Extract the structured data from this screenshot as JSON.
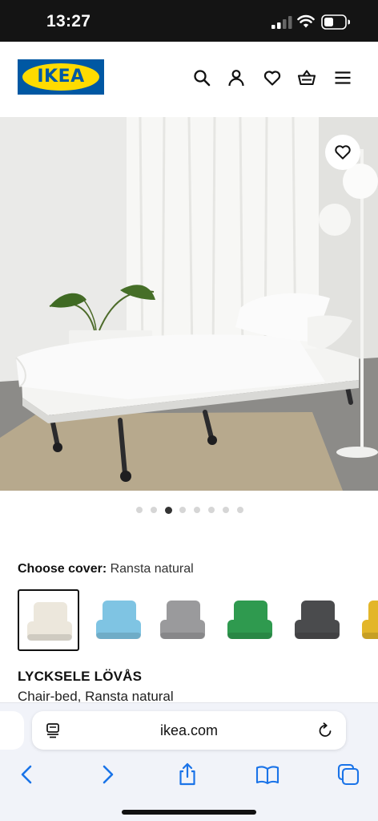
{
  "status_bar": {
    "time": "13:27"
  },
  "header": {
    "logo_text": "IKEA",
    "icons": [
      "search-icon",
      "user-icon",
      "heart-icon",
      "basket-icon",
      "menu-icon"
    ]
  },
  "hero": {
    "favourite_icon": "heart-icon",
    "carousel": {
      "count": 8,
      "active_index": 2
    }
  },
  "cover": {
    "label": "Choose cover:",
    "value": "Ransta natural",
    "swatches": [
      {
        "name": "ransta-natural",
        "color": "#ece7dc",
        "selected": true
      },
      {
        "name": "multicolour",
        "color": "#7fc4e3",
        "selected": false
      },
      {
        "name": "grey",
        "color": "#9a9a9c",
        "selected": false
      },
      {
        "name": "green",
        "color": "#2f9a4f",
        "selected": false
      },
      {
        "name": "dark-grey",
        "color": "#4a4b4d",
        "selected": false
      },
      {
        "name": "yellow",
        "color": "#e3b62a",
        "selected": false
      }
    ]
  },
  "product": {
    "name": "LYCKSELE LÖVÅS",
    "description": "Chair-bed, Ransta natural"
  },
  "browser": {
    "url": "ikea.com",
    "toolbar_icons": [
      "back-icon",
      "forward-icon",
      "share-icon",
      "bookmarks-icon",
      "tabs-icon"
    ]
  },
  "colors": {
    "ikea_blue": "#0058a3",
    "ikea_yellow": "#ffdb00",
    "status_bar": "#141414",
    "safari_accent": "#1a73e8"
  }
}
